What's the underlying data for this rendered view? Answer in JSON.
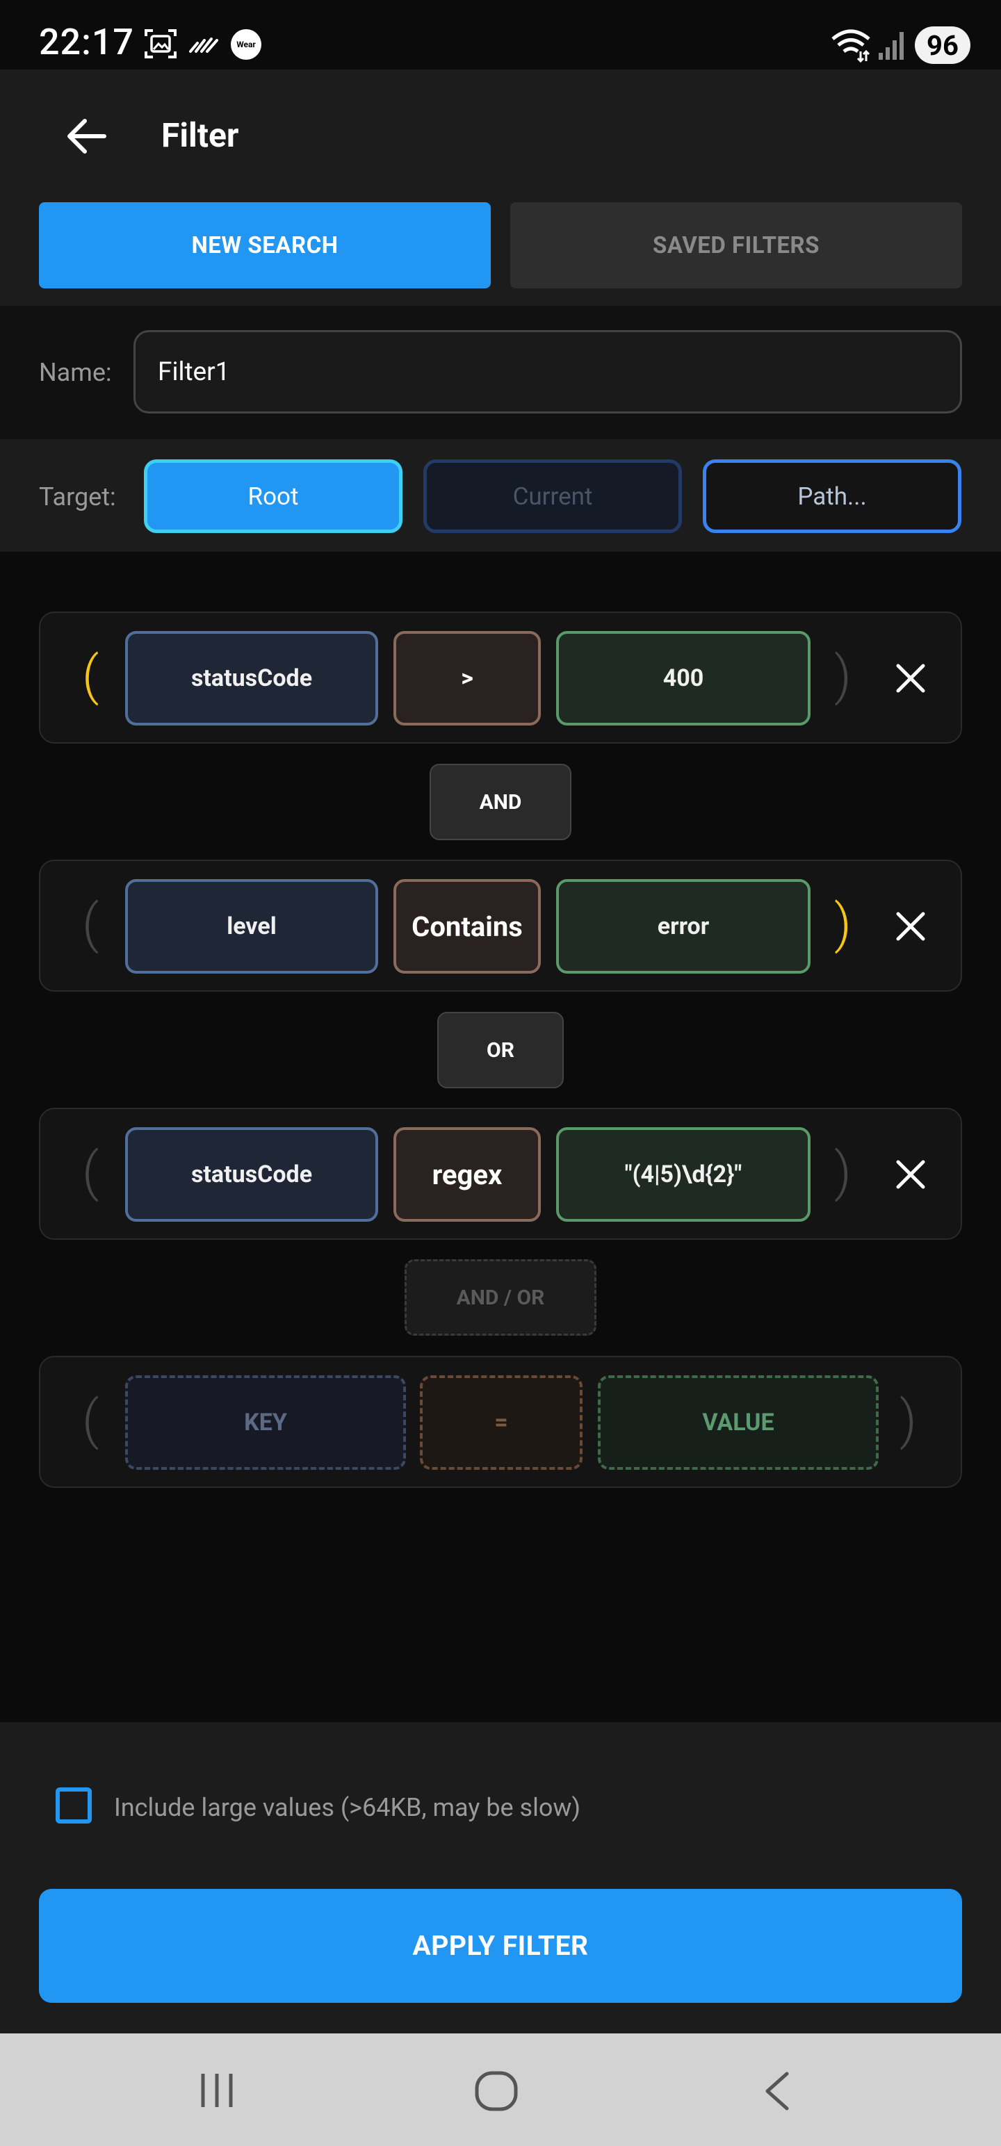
{
  "status_bar": {
    "time": "22:17",
    "wear_badge": "Wear",
    "battery": "96",
    "icons": [
      "gallery-icon",
      "signal-dash-icon",
      "wear-icon",
      "wifi-icon",
      "cell-signal-icon"
    ]
  },
  "header": {
    "title": "Filter",
    "back_icon": "arrow-left-icon"
  },
  "tabs": {
    "new_search": "NEW SEARCH",
    "saved_filters": "SAVED FILTERS",
    "active": "new_search"
  },
  "name_row": {
    "label": "Name:",
    "value": "Filter1"
  },
  "target_row": {
    "label": "Target:",
    "options": [
      "Root",
      "Current",
      "Path..."
    ],
    "selected": "Root"
  },
  "conditions": [
    {
      "open_paren": "(",
      "key": "statusCode",
      "op": ">",
      "value": "400",
      "close_paren": ")",
      "open_active": true,
      "close_active": false
    },
    {
      "open_paren": "(",
      "key": "level",
      "op": "Contains",
      "value": "error",
      "close_paren": ")",
      "open_active": false,
      "close_active": true
    },
    {
      "open_paren": "(",
      "key": "statusCode",
      "op": "regex",
      "value": "\"(4|5)\\d{2}\"",
      "close_paren": ")",
      "open_active": false,
      "close_active": false
    }
  ],
  "connectors": [
    "AND",
    "OR"
  ],
  "placeholder_connector": "AND / OR",
  "placeholder_condition": {
    "open_paren": "(",
    "key": "KEY",
    "op": "=",
    "value": "VALUE",
    "close_paren": ")"
  },
  "options": {
    "include_large_label": "Include large values (>64KB, may be slow)",
    "include_large_checked": false
  },
  "apply_button": "APPLY FILTER",
  "colors": {
    "accent": "#2196f3",
    "paren_active": "#f5c518",
    "key_border": "#50709a",
    "op_border": "#8a6a5a",
    "value_border": "#5a9a6a"
  }
}
